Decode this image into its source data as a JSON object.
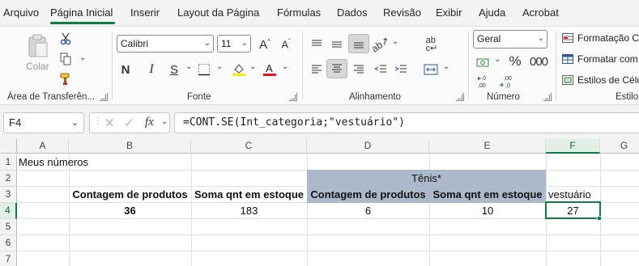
{
  "menu": {
    "tabs": [
      "Arquivo",
      "Página Inicial",
      "Inserir",
      "Layout da Página",
      "Fórmulas",
      "Dados",
      "Revisão",
      "Exibir",
      "Ajuda",
      "Acrobat"
    ]
  },
  "ribbon": {
    "clipboard": {
      "paste_label": "Colar",
      "group_label": "Área de Transferên..."
    },
    "font": {
      "name": "Calibri",
      "size": "11",
      "bold": "N",
      "group_label": "Fonte"
    },
    "alignment": {
      "group_label": "Alinhamento"
    },
    "number": {
      "format": "Geral",
      "percent": "%",
      "group_label": "Número"
    },
    "styles": {
      "items": [
        "Formatação C",
        "Formatar com",
        "Estilos de Célu"
      ],
      "group_label": "Estilo"
    }
  },
  "formula_bar": {
    "name_box": "F4",
    "fx": "fx",
    "formula": "=CONT.SE(Int_categoria;\"vestuário\")"
  },
  "grid": {
    "columns": [
      "A",
      "B",
      "C",
      "D",
      "E",
      "F",
      "G"
    ],
    "rows": [
      "1",
      "2",
      "3",
      "4",
      "5",
      "6",
      "7"
    ],
    "cells": {
      "a1": "Meus números",
      "d2": "Tênis*",
      "b3": "Contagem de produtos",
      "c3": "Soma qnt em estoque",
      "d3": "Contagem de produtos",
      "e3": "Soma qnt em estoque",
      "f3": "vestuário",
      "b4": "36",
      "c4": "183",
      "d4": "6",
      "e4": "10",
      "f4": "27"
    },
    "colors": {
      "header_shade": "#acb9ca",
      "selection": "#107c41"
    }
  }
}
